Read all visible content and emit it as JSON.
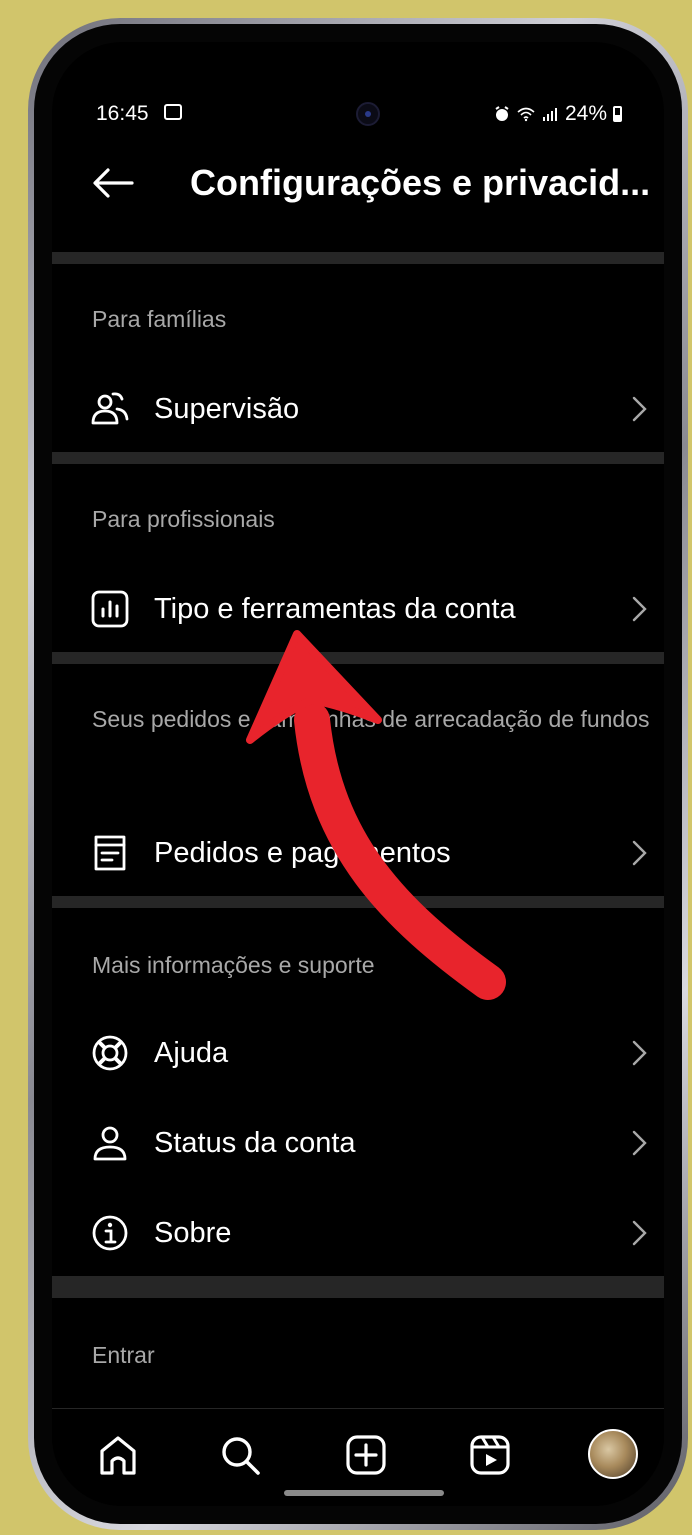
{
  "status_bar": {
    "time": "16:45",
    "battery": "24%"
  },
  "header": {
    "title": "Configurações e privacid..."
  },
  "sections": [
    {
      "header": "Para famílias",
      "items": [
        {
          "label": "Supervisão",
          "icon": "supervision-icon"
        }
      ]
    },
    {
      "header": "Para profissionais",
      "items": [
        {
          "label": "Tipo e ferramentas da conta",
          "icon": "insights-chart-icon"
        }
      ]
    },
    {
      "header": "Seus pedidos e campanhas de arrecadação de fundos",
      "items": [
        {
          "label": "Pedidos e pagamentos",
          "icon": "receipt-icon"
        }
      ]
    },
    {
      "header": "Mais informações e suporte",
      "items": [
        {
          "label": "Ajuda",
          "icon": "lifebuoy-icon"
        },
        {
          "label": "Status da conta",
          "icon": "person-icon"
        },
        {
          "label": "Sobre",
          "icon": "info-icon"
        }
      ]
    },
    {
      "header": "Entrar",
      "items": []
    }
  ],
  "bottom_nav": [
    "home-icon",
    "search-icon",
    "create-icon",
    "reels-icon",
    "profile-avatar"
  ],
  "colors": {
    "background": "#000000",
    "text": "#ffffff",
    "secondary_text": "#a8a8a8",
    "divider": "#262626",
    "annotation": "#e8242c",
    "frame_bg": "#d1c56b"
  }
}
